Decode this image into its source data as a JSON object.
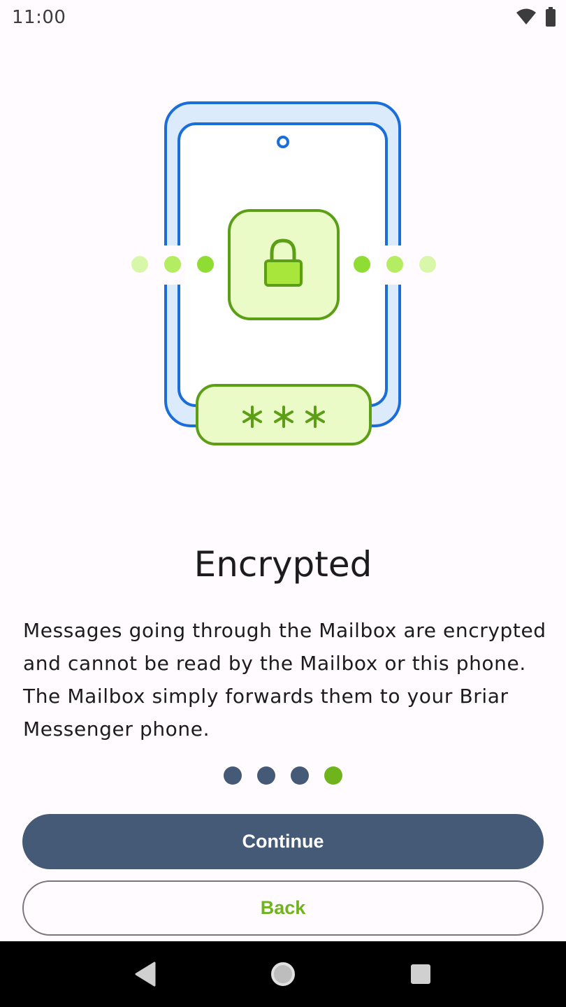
{
  "status_bar": {
    "time": "11:00",
    "icons": [
      "wifi-icon",
      "battery-icon"
    ]
  },
  "onboarding": {
    "title": "Encrypted",
    "body": "Messages going through the Mailbox are encrypted and cannot be read by the Mailbox or this phone. The Mailbox simply forwards them to your Briar Messenger phone.",
    "pager": {
      "total": 4,
      "current": 4
    }
  },
  "actions": {
    "continue_label": "Continue",
    "back_label": "Back"
  },
  "nav_bar": {
    "icons": [
      "back-triangle-icon",
      "home-circle-icon",
      "recents-square-icon"
    ]
  },
  "colors": {
    "primary": "#455a76",
    "accent_green": "#6fb41c",
    "phone_blue": "#1a6ed8",
    "phone_fill": "#dcebfc",
    "lock_fill": "#eafbc8",
    "background": "#fffbfe"
  }
}
